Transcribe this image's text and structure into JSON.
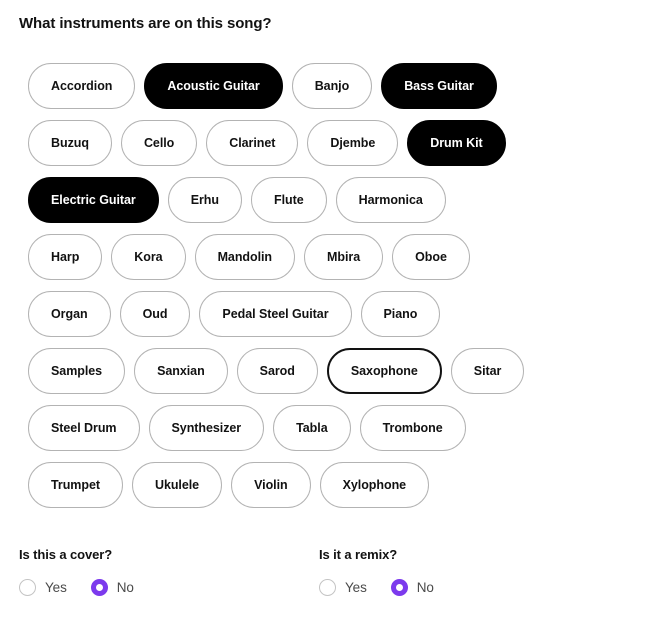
{
  "form": {
    "question_title": "What instruments are on this song?",
    "instrument_rows": [
      [
        {
          "label": "Accordion",
          "state": "default"
        },
        {
          "label": "Acoustic Guitar",
          "state": "selected"
        },
        {
          "label": "Banjo",
          "state": "default"
        },
        {
          "label": "Bass Guitar",
          "state": "selected"
        }
      ],
      [
        {
          "label": "Buzuq",
          "state": "default"
        },
        {
          "label": "Cello",
          "state": "default"
        },
        {
          "label": "Clarinet",
          "state": "default"
        },
        {
          "label": "Djembe",
          "state": "default"
        },
        {
          "label": "Drum Kit",
          "state": "selected"
        }
      ],
      [
        {
          "label": "Electric Guitar",
          "state": "selected"
        },
        {
          "label": "Erhu",
          "state": "default"
        },
        {
          "label": "Flute",
          "state": "default"
        },
        {
          "label": "Harmonica",
          "state": "default"
        }
      ],
      [
        {
          "label": "Harp",
          "state": "default"
        },
        {
          "label": "Kora",
          "state": "default"
        },
        {
          "label": "Mandolin",
          "state": "default"
        },
        {
          "label": "Mbira",
          "state": "default"
        },
        {
          "label": "Oboe",
          "state": "default"
        }
      ],
      [
        {
          "label": "Organ",
          "state": "default"
        },
        {
          "label": "Oud",
          "state": "default"
        },
        {
          "label": "Pedal Steel Guitar",
          "state": "default"
        },
        {
          "label": "Piano",
          "state": "default"
        }
      ],
      [
        {
          "label": "Samples",
          "state": "default"
        },
        {
          "label": "Sanxian",
          "state": "default"
        },
        {
          "label": "Sarod",
          "state": "default"
        },
        {
          "label": "Saxophone",
          "state": "hovered"
        },
        {
          "label": "Sitar",
          "state": "default"
        }
      ],
      [
        {
          "label": "Steel Drum",
          "state": "default"
        },
        {
          "label": "Synthesizer",
          "state": "default"
        },
        {
          "label": "Tabla",
          "state": "default"
        },
        {
          "label": "Trombone",
          "state": "default"
        }
      ],
      [
        {
          "label": "Trumpet",
          "state": "default"
        },
        {
          "label": "Ukulele",
          "state": "default"
        },
        {
          "label": "Violin",
          "state": "default"
        },
        {
          "label": "Xylophone",
          "state": "default"
        }
      ]
    ],
    "cover_question": {
      "label": "Is this a cover?",
      "options": [
        {
          "label": "Yes",
          "checked": false
        },
        {
          "label": "No",
          "checked": true
        }
      ]
    },
    "remix_question": {
      "label": "Is it a remix?",
      "options": [
        {
          "label": "Yes",
          "checked": false
        },
        {
          "label": "No",
          "checked": true
        }
      ]
    }
  },
  "colors": {
    "selected_chip_bg": "#000000",
    "selected_chip_text": "#ffffff",
    "chip_border": "#b3b3b3",
    "hover_chip_border": "#121212",
    "radio_accent": "#7c3aed",
    "text": "#121212",
    "background": "#ffffff"
  }
}
